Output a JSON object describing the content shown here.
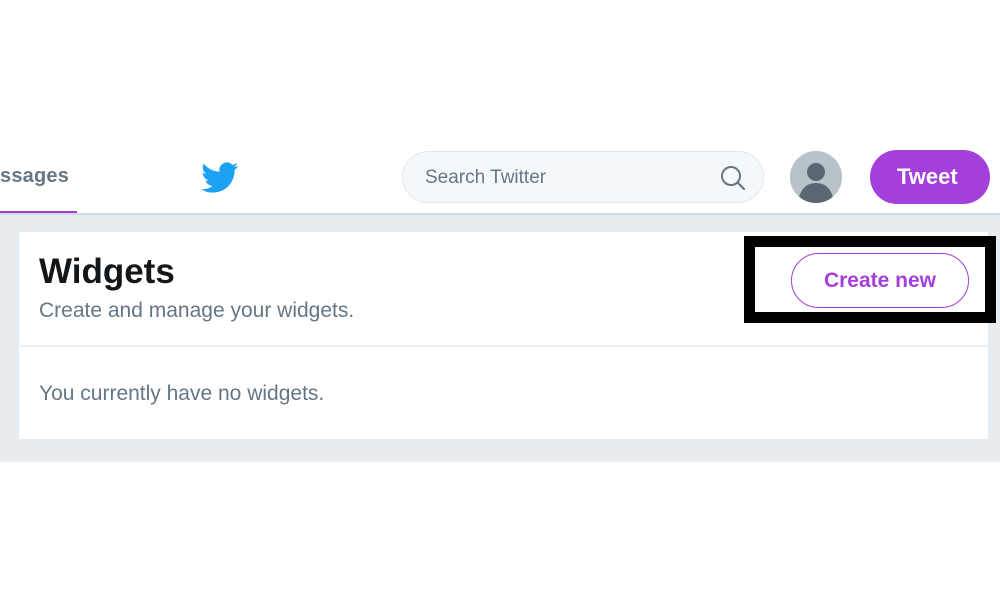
{
  "nav": {
    "active_tab_label": "ssages",
    "search": {
      "placeholder": "Search Twitter",
      "value": ""
    },
    "tweet_label": "Tweet",
    "accent_color": "#a43fdb",
    "twitter_blue": "#1da1f2"
  },
  "widgets": {
    "title": "Widgets",
    "subtitle": "Create and manage your widgets.",
    "create_label": "Create new",
    "empty_message": "You currently have no widgets."
  }
}
